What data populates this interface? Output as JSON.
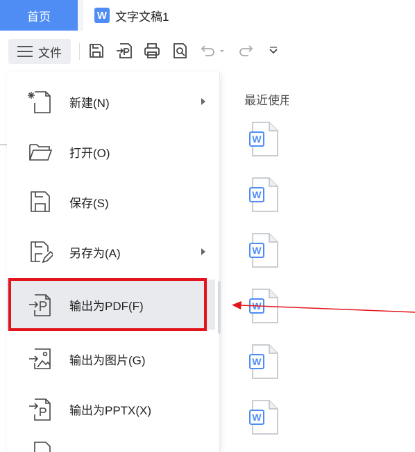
{
  "tabs": {
    "home_label": "首页",
    "doc_icon_letter": "W",
    "doc_title": "文字文稿1"
  },
  "toolbar": {
    "file_label": "文件",
    "tools": [
      "save-icon",
      "export-pdf-icon",
      "print-icon",
      "print-preview-icon",
      "undo-icon",
      "undo-dropdown-icon",
      "redo-icon",
      "more-chevron-icon"
    ]
  },
  "menu": {
    "items": [
      {
        "label": "新建(N)",
        "icon": "new-file-icon",
        "submenu": true
      },
      {
        "label": "打开(O)",
        "icon": "folder-open-icon",
        "submenu": false
      },
      {
        "label": "保存(S)",
        "icon": "save-icon",
        "submenu": false
      },
      {
        "label": "另存为(A)",
        "icon": "save-as-icon",
        "submenu": true
      },
      {
        "label": "输出为PDF(F)",
        "icon": "export-pdf-icon",
        "submenu": false,
        "hovered": true
      },
      {
        "label": "输出为图片(G)",
        "icon": "export-image-icon",
        "submenu": false
      },
      {
        "label": "输出为PPTX(X)",
        "icon": "export-pptx-icon",
        "submenu": false
      }
    ]
  },
  "recent": {
    "title": "最近使用",
    "file_icon_letter": "W",
    "file_count": 6
  },
  "colors": {
    "accent": "#4f8df5",
    "highlight": "#e3141b",
    "hover_bg": "#e8eaee"
  }
}
